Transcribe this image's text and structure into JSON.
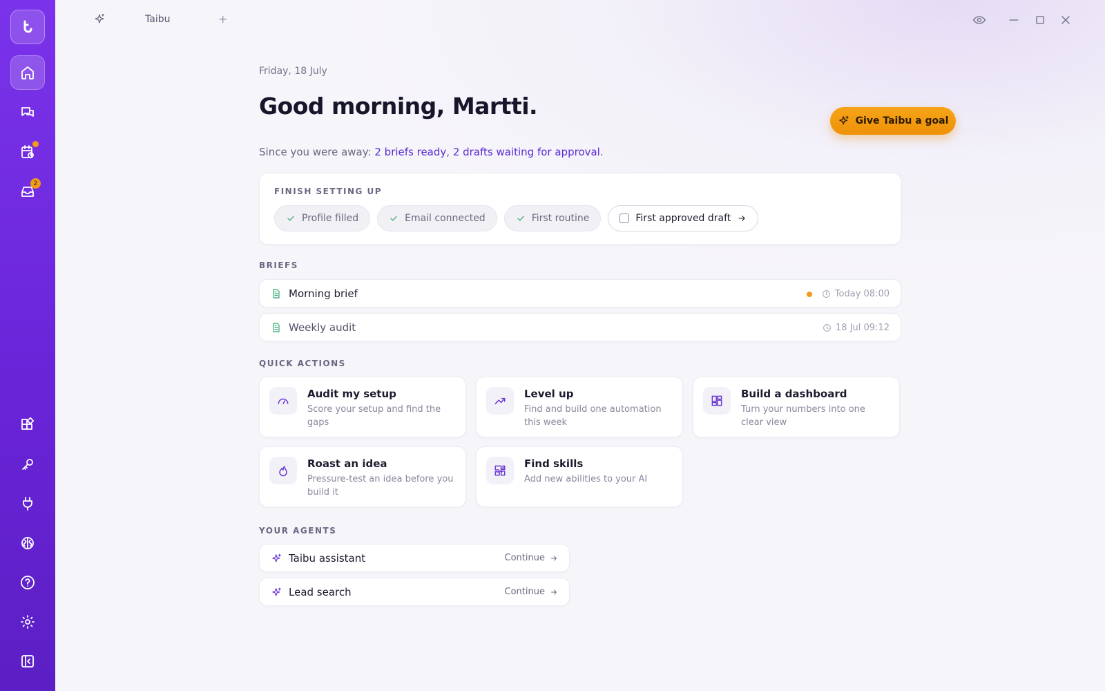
{
  "window": {
    "tab_title": "Taibu",
    "new_tab": "+"
  },
  "sidebar": {
    "items": [
      {
        "name": "home",
        "active": true
      },
      {
        "name": "chats"
      },
      {
        "name": "schedule",
        "notification_dot": true
      },
      {
        "name": "inbox",
        "badge": "2"
      },
      {
        "name": "apps"
      },
      {
        "name": "keys"
      },
      {
        "name": "integrations"
      },
      {
        "name": "brain"
      },
      {
        "name": "help"
      },
      {
        "name": "settings"
      },
      {
        "name": "collapse"
      }
    ]
  },
  "header": {
    "date": "Friday, 18 July",
    "greeting": "Good morning, Martti.",
    "goal_button": "Give Taibu a goal",
    "since_prefix": "Since you were away: ",
    "briefs_link": "2 briefs ready",
    "separator": ", ",
    "drafts_link": "2 drafts waiting for approval",
    "since_suffix": "."
  },
  "setup": {
    "title": "FINISH SETTING UP",
    "chips": [
      {
        "label": "Profile filled",
        "done": true
      },
      {
        "label": "Email connected",
        "done": true
      },
      {
        "label": "First routine",
        "done": true
      },
      {
        "label": "First approved draft",
        "done": false
      }
    ]
  },
  "briefs": {
    "title": "BRIEFS",
    "items": [
      {
        "name": "Morning brief",
        "time": "Today 08:00",
        "unread": true
      },
      {
        "name": "Weekly audit",
        "time": "18 Jul 09:12",
        "unread": false
      }
    ]
  },
  "quick_actions": {
    "title": "QUICK ACTIONS",
    "items": [
      {
        "title": "Audit my setup",
        "desc": "Score your setup and find the gaps",
        "icon": "gauge-icon"
      },
      {
        "title": "Level up",
        "desc": "Find and build one automation this week",
        "icon": "trending-up-icon"
      },
      {
        "title": "Build a dashboard",
        "desc": "Turn your numbers into one clear view",
        "icon": "dashboard-icon"
      },
      {
        "title": "Roast an idea",
        "desc": "Pressure-test an idea before you build it",
        "icon": "flame-icon"
      },
      {
        "title": "Find skills",
        "desc": "Add new abilities to your AI",
        "icon": "puzzle-icon"
      }
    ]
  },
  "agents": {
    "title": "YOUR AGENTS",
    "items": [
      {
        "name": "Taibu assistant",
        "action": "Continue"
      },
      {
        "name": "Lead search",
        "action": "Continue"
      }
    ]
  },
  "colors": {
    "sidebar": "#6a24d8",
    "accent": "#5b2bd2",
    "cta": "#f39b16",
    "success": "#2aa36a"
  }
}
